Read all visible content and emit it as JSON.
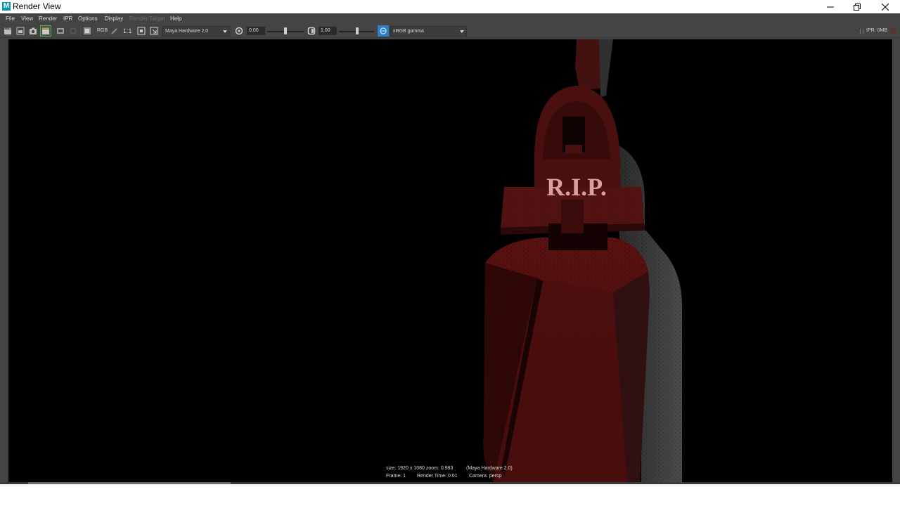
{
  "window": {
    "title": "Render View",
    "app_icon_letter": "M",
    "controls": [
      "minimize-icon",
      "restore-icon",
      "close-icon"
    ]
  },
  "menubar": {
    "items": [
      {
        "label": "File",
        "enabled": true
      },
      {
        "label": "View",
        "enabled": true
      },
      {
        "label": "Render",
        "enabled": true
      },
      {
        "label": "IPR",
        "enabled": true
      },
      {
        "label": "Options",
        "enabled": true
      },
      {
        "label": "Display",
        "enabled": true
      },
      {
        "label": "Render Target",
        "enabled": false
      },
      {
        "label": "Help",
        "enabled": true
      }
    ]
  },
  "toolbar": {
    "rgb_label": "RGB",
    "one_to_one_label": "1:1",
    "renderer": "Maya Hardware 2.0",
    "exposure_value": "0.00",
    "gamma_value": "1.00",
    "colorspace": "sRGB gamma",
    "ipr_status": "IPR: 0MB"
  },
  "render_info": {
    "size_line": "size: 1920 x 1080 zoom: 0.983",
    "renderer_line": "(Maya Hardware 2.0)",
    "frame": "Frame: 1",
    "render_time": "Render Time: 0:01",
    "camera": "Camera: persp"
  },
  "render_image": {
    "tombstone_text": "R.I.P.",
    "colors": {
      "background": "#000000",
      "stone_red": "#5a0f0f",
      "stone_grey": "#3c3c3c",
      "text_pink": "#d9a0a0"
    }
  },
  "colors": {
    "panel": "#444444",
    "menu_text": "#dcdcdc",
    "disabled_text": "#6e6e6e",
    "accent_blue": "#2d7fc2"
  }
}
